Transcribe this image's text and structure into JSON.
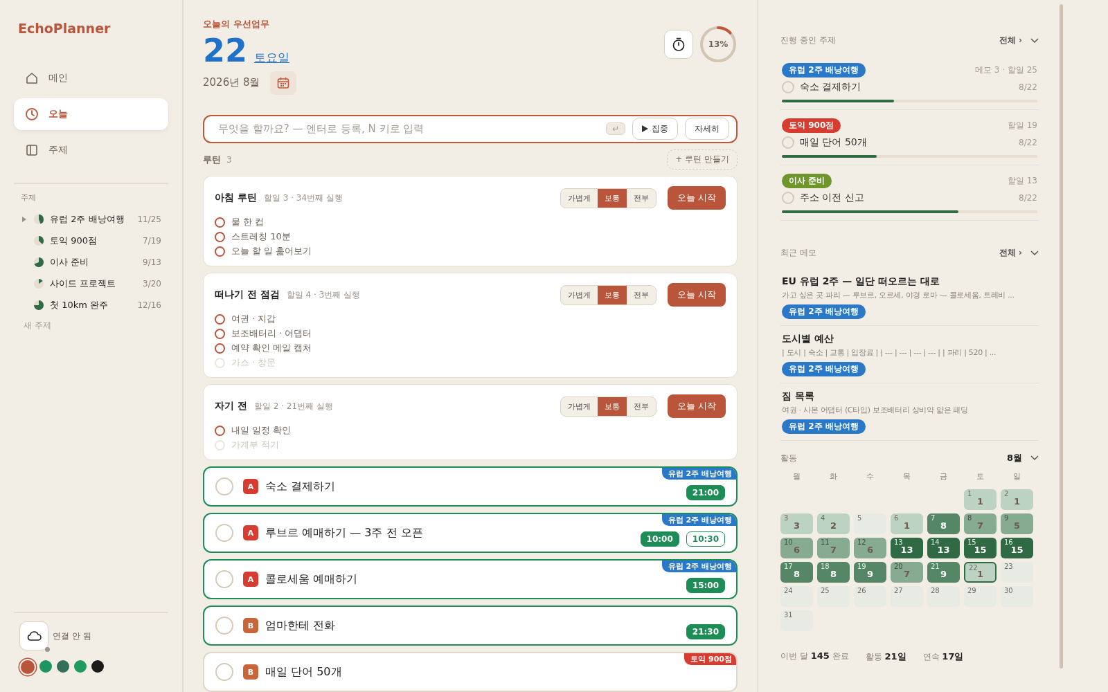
{
  "app": {
    "name": "EchoPlanner"
  },
  "nav": [
    {
      "label": "메인",
      "selected": false
    },
    {
      "label": "오늘",
      "selected": true
    },
    {
      "label": "주제",
      "selected": false
    }
  ],
  "topics_section": {
    "title": "주제",
    "add_label": "새 주제"
  },
  "topics": [
    {
      "name": "유럽 2주 배낭여행",
      "count": "11/25",
      "expanded": false
    },
    {
      "name": "토익 900점",
      "count": "7/19"
    },
    {
      "name": "이사 준비",
      "count": "9/13"
    },
    {
      "name": "사이드 프로젝트",
      "count": "3/20"
    },
    {
      "name": "첫 10km 완주",
      "count": "12/16"
    }
  ],
  "sync": {
    "label": "연결 안 됨",
    "connected": false
  },
  "themes": [
    {
      "color": "#b9553a",
      "selected": true
    },
    {
      "color": "#1e9460",
      "selected": false
    },
    {
      "color": "#33705a",
      "selected": false
    },
    {
      "color": "#1f9b5e",
      "selected": false
    },
    {
      "color": "#1b1b1b",
      "selected": false
    }
  ],
  "header": {
    "eyebrow": "오늘의 우선업무",
    "day": "22",
    "weekday": "토요일",
    "month": "2026년 8월",
    "progress_label": "13%",
    "level": 0.13
  },
  "quick_add": {
    "placeholder": "무엇을 할까요? — 엔터로 등록, N 키로 입력",
    "enter_key": "↵",
    "focus_label": "집중",
    "detail_label": "자세히"
  },
  "routines_header": {
    "title": "루틴",
    "count": "3",
    "create_label": "+ 루틴 만들기"
  },
  "routines": [
    {
      "title": "아침 루틴",
      "meta": "할일 3 · 34번째 실행",
      "modes": [
        {
          "label": "가볍게",
          "selected": false
        },
        {
          "label": "보통",
          "selected": true
        },
        {
          "label": "전부",
          "selected": false
        }
      ],
      "start_label": "오늘 시작",
      "items": [
        {
          "label": "물 한 컵",
          "disabled": false
        },
        {
          "label": "스트레칭 10분",
          "disabled": false
        },
        {
          "label": "오늘 할 일 훑어보기",
          "disabled": false
        }
      ]
    },
    {
      "title": "떠나기 전 점검",
      "meta": "할일 4 · 3번째 실행",
      "modes": [
        {
          "label": "가볍게",
          "selected": false
        },
        {
          "label": "보통",
          "selected": true
        },
        {
          "label": "전부",
          "selected": false
        }
      ],
      "start_label": "오늘 시작",
      "items": [
        {
          "label": "여권 · 지갑",
          "disabled": false
        },
        {
          "label": "보조배터리 · 어댑터",
          "disabled": false
        },
        {
          "label": "예약 확인 메일 캡처",
          "disabled": false
        },
        {
          "label": "가스 · 창문",
          "disabled": true
        }
      ]
    },
    {
      "title": "자기 전",
      "meta": "할일 2 · 21번째 실행",
      "modes": [
        {
          "label": "가볍게",
          "selected": false
        },
        {
          "label": "보통",
          "selected": true
        },
        {
          "label": "전부",
          "selected": false
        }
      ],
      "start_label": "오늘 시작",
      "items": [
        {
          "label": "내일 일정 확인",
          "disabled": false
        },
        {
          "label": "가계부 적기",
          "disabled": true
        }
      ]
    }
  ],
  "tasks": [
    {
      "title": "숙소 결제하기",
      "priority": {
        "label": "A",
        "color": "#d63c2f"
      },
      "tag": {
        "label": "유럽 2주 배낭여행",
        "color": "#2a78c8"
      },
      "checked": false,
      "scheduled": true,
      "times": [
        {
          "label": "21:00",
          "kind": "filled"
        }
      ]
    },
    {
      "title": "루브르 예매하기 — 3주 전 오픈",
      "priority": {
        "label": "A",
        "color": "#d63c2f"
      },
      "tag": {
        "label": "유럽 2주 배낭여행",
        "color": "#2a78c8"
      },
      "checked": false,
      "scheduled": true,
      "times": [
        {
          "label": "10:00",
          "kind": "filled"
        },
        {
          "label": "10:30",
          "kind": "outline"
        }
      ]
    },
    {
      "title": "콜로세움 예매하기",
      "priority": {
        "label": "A",
        "color": "#d63c2f"
      },
      "tag": {
        "label": "유럽 2주 배낭여행",
        "color": "#2a78c8"
      },
      "checked": false,
      "scheduled": true,
      "times": [
        {
          "label": "15:00",
          "kind": "filled"
        }
      ]
    },
    {
      "title": "엄마한테 전화",
      "priority": {
        "label": "B",
        "color": "#c8663a"
      },
      "checked": false,
      "scheduled": true,
      "times": [
        {
          "label": "21:30",
          "kind": "filled"
        }
      ]
    },
    {
      "title": "매일 단어 50개",
      "priority": {
        "label": "B",
        "color": "#c8663a"
      },
      "tag": {
        "label": "토익 900점",
        "color": "#d63c2f"
      },
      "checked": false,
      "scheduled": false
    }
  ],
  "active_topics": {
    "title": "진행 중인 주제",
    "all_label": "전체 ›",
    "items": [
      {
        "tag": "유럽 2주 배낭여행",
        "color": "#2a78c8",
        "meta": "메모 3 · 할일 25",
        "task": "숙소 결제하기",
        "checked": false,
        "date": "8/22",
        "level": 0.44
      },
      {
        "tag": "토익 900점",
        "color": "#d63c2f",
        "meta": "할일 19",
        "task": "매일 단어 50개",
        "checked": false,
        "date": "8/22",
        "level": 0.37
      },
      {
        "tag": "이사 준비",
        "color": "#6f962b",
        "meta": "할일 13",
        "task": "주소 이전 신고",
        "checked": false,
        "date": "8/22",
        "level": 0.69
      }
    ]
  },
  "recent_memos": {
    "title": "최근 메모",
    "all_label": "전체 ›",
    "items": [
      {
        "title": "EU 유럽 2주 — 일단 떠오르는 대로",
        "preview": "가고 싶은 곳 파리 — 루브르, 오르세, 야경 로마 — 콜로세움, 트레비 ...",
        "tag": "유럽 2주 배낭여행",
        "color": "#2a78c8"
      },
      {
        "title": "도시별 예산",
        "preview": "| 도시 | 숙소 | 교통 | 입장료 | | --- | --- | --- | --- | | 파리 | 520 | ...",
        "tag": "유럽 2주 배낭여행",
        "color": "#2a78c8"
      },
      {
        "title": "짐 목록",
        "preview": "여권 · 사본 어댑터 (C타입) 보조배터리 상비약 얇은 패딩",
        "tag": "유럽 2주 배낭여행",
        "color": "#2a78c8"
      }
    ]
  },
  "activity": {
    "title": "활동",
    "month": "8월",
    "weekdays": [
      "월",
      "화",
      "수",
      "목",
      "금",
      "토",
      "일"
    ],
    "days": [
      {
        "date": "1",
        "count": "1",
        "kind": "low",
        "selected": false
      },
      {
        "date": "2",
        "count": "1",
        "kind": "low",
        "selected": false
      },
      {
        "date": "3",
        "count": "3",
        "kind": "low",
        "selected": false
      },
      {
        "date": "4",
        "count": "2",
        "kind": "low",
        "selected": false
      },
      {
        "date": "5",
        "kind": "none",
        "selected": false
      },
      {
        "date": "6",
        "count": "1",
        "kind": "low",
        "selected": false
      },
      {
        "date": "7",
        "count": "8",
        "kind": "high",
        "selected": false
      },
      {
        "date": "8",
        "count": "7",
        "kind": "mid",
        "selected": false
      },
      {
        "date": "9",
        "count": "5",
        "kind": "mid",
        "selected": false
      },
      {
        "date": "10",
        "count": "6",
        "kind": "mid",
        "selected": false
      },
      {
        "date": "11",
        "count": "7",
        "kind": "mid",
        "selected": false
      },
      {
        "date": "12",
        "count": "6",
        "kind": "mid",
        "selected": false
      },
      {
        "date": "13",
        "count": "13",
        "kind": "max",
        "selected": false
      },
      {
        "date": "14",
        "count": "13",
        "kind": "max",
        "selected": false
      },
      {
        "date": "15",
        "count": "15",
        "kind": "max",
        "selected": false
      },
      {
        "date": "16",
        "count": "15",
        "kind": "max",
        "selected": false
      },
      {
        "date": "17",
        "count": "8",
        "kind": "high",
        "selected": false
      },
      {
        "date": "18",
        "count": "8",
        "kind": "high",
        "selected": false
      },
      {
        "date": "19",
        "count": "9",
        "kind": "high",
        "selected": false
      },
      {
        "date": "20",
        "count": "7",
        "kind": "mid",
        "selected": false
      },
      {
        "date": "21",
        "count": "9",
        "kind": "high",
        "selected": false
      },
      {
        "date": "22",
        "count": "1",
        "kind": "low",
        "selected": true
      },
      {
        "date": "23",
        "kind": "none",
        "selected": false
      },
      {
        "date": "24",
        "kind": "none",
        "selected": false
      },
      {
        "date": "25",
        "kind": "none",
        "selected": false
      },
      {
        "date": "26",
        "kind": "none",
        "selected": false
      },
      {
        "date": "27",
        "kind": "none",
        "selected": false
      },
      {
        "date": "28",
        "kind": "none",
        "selected": false
      },
      {
        "date": "29",
        "kind": "none",
        "selected": false
      },
      {
        "date": "30",
        "kind": "none",
        "selected": false
      },
      {
        "date": "31",
        "kind": "none",
        "selected": false
      }
    ],
    "summary": [
      "이번 달 **145** 완료",
      "활동 **21일**",
      "연속 **17일**"
    ]
  }
}
